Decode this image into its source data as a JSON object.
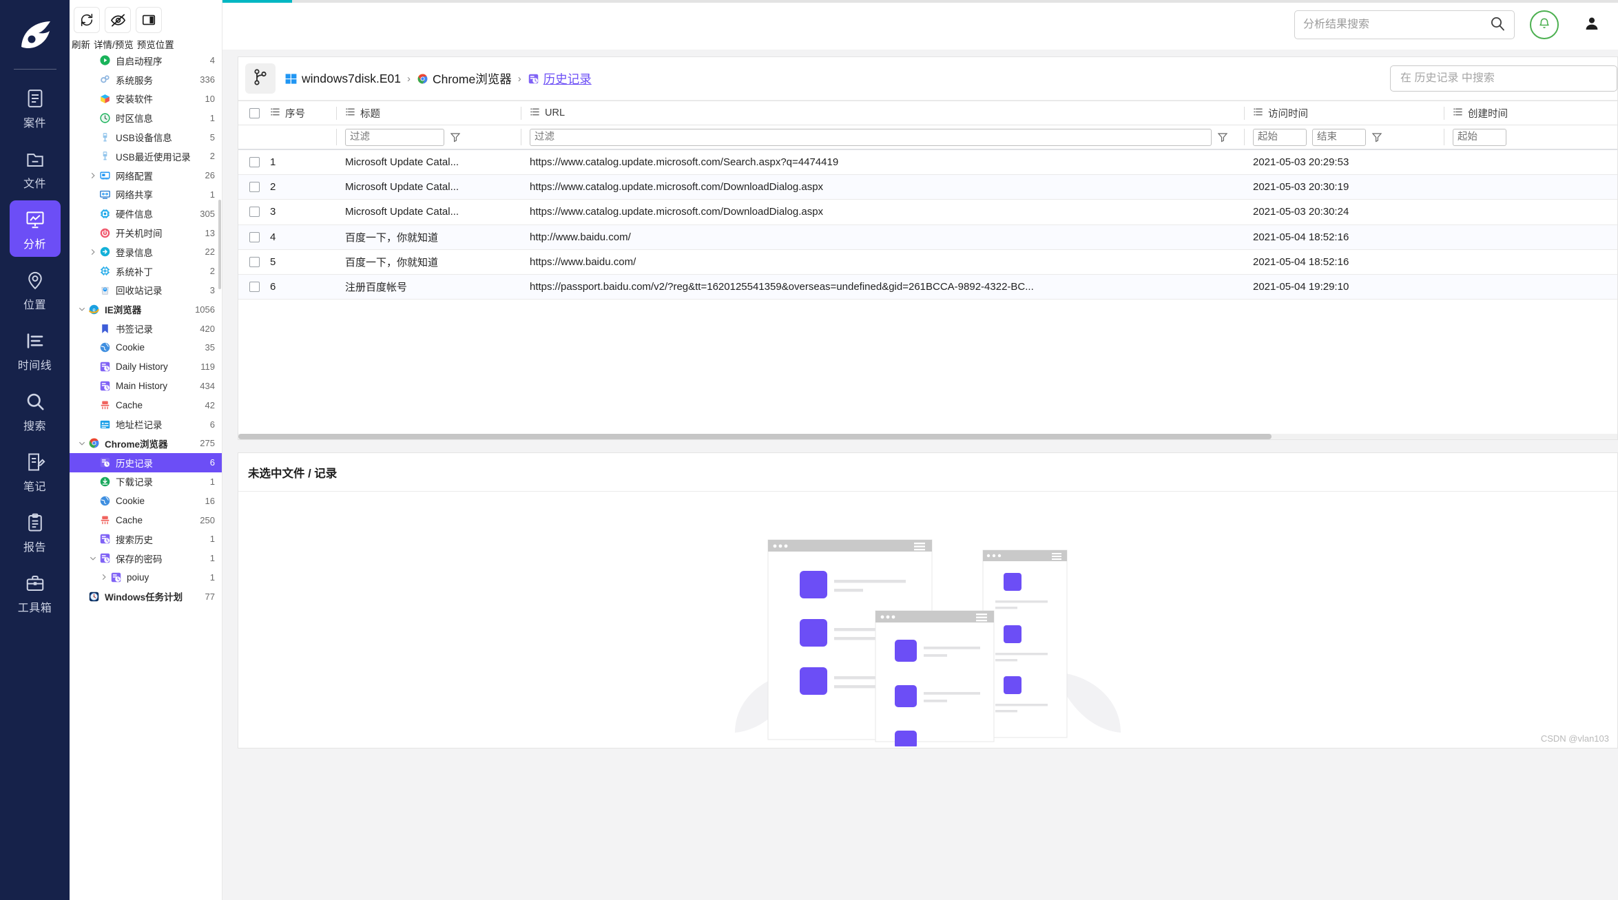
{
  "rail": {
    "logo_name": "app-logo",
    "items": [
      {
        "label": "案件",
        "icon": "case-icon",
        "active": false
      },
      {
        "label": "文件",
        "icon": "folder-icon",
        "active": false
      },
      {
        "label": "分析",
        "icon": "analysis-icon",
        "active": true
      },
      {
        "label": "位置",
        "icon": "location-icon",
        "active": false
      },
      {
        "label": "时间线",
        "icon": "timeline-icon",
        "active": false
      },
      {
        "label": "搜索",
        "icon": "search-icon",
        "active": false
      },
      {
        "label": "笔记",
        "icon": "note-icon",
        "active": false
      },
      {
        "label": "报告",
        "icon": "report-icon",
        "active": false
      },
      {
        "label": "工具箱",
        "icon": "toolbox-icon",
        "active": false
      }
    ]
  },
  "toolbar": {
    "buttons": [
      {
        "icon": "refresh-icon",
        "name": "refresh-button"
      },
      {
        "icon": "eye-off-icon",
        "name": "detail-preview-button"
      },
      {
        "icon": "panel-icon",
        "name": "preview-position-button"
      }
    ],
    "labels": [
      "刷新",
      "详情/预览",
      "预览位置"
    ]
  },
  "tree": [
    {
      "label": "自启动程序",
      "count": "4",
      "icon": "play-green-icon",
      "indent": 1,
      "caret": "none"
    },
    {
      "label": "系统服务",
      "count": "336",
      "icon": "gears-icon",
      "indent": 1,
      "caret": "none"
    },
    {
      "label": "安装软件",
      "count": "10",
      "icon": "box-icon",
      "indent": 1,
      "caret": "none"
    },
    {
      "label": "时区信息",
      "count": "1",
      "icon": "clock-icon",
      "indent": 1,
      "caret": "none"
    },
    {
      "label": "USB设备信息",
      "count": "5",
      "icon": "usb-icon",
      "indent": 1,
      "caret": "none"
    },
    {
      "label": "USB最近使用记录",
      "count": "2",
      "icon": "usb-icon",
      "indent": 1,
      "caret": "none"
    },
    {
      "label": "网络配置",
      "count": "26",
      "icon": "netcard-icon",
      "indent": 1,
      "caret": "right"
    },
    {
      "label": "网络共享",
      "count": "1",
      "icon": "netshare-icon",
      "indent": 1,
      "caret": "none"
    },
    {
      "label": "硬件信息",
      "count": "305",
      "icon": "chip-icon",
      "indent": 1,
      "caret": "none"
    },
    {
      "label": "开关机时间",
      "count": "13",
      "icon": "power-icon",
      "indent": 1,
      "caret": "none"
    },
    {
      "label": "登录信息",
      "count": "22",
      "icon": "login-icon",
      "indent": 1,
      "caret": "right"
    },
    {
      "label": "系统补丁",
      "count": "2",
      "icon": "patch-icon",
      "indent": 1,
      "caret": "none"
    },
    {
      "label": "回收站记录",
      "count": "3",
      "icon": "recycle-icon",
      "indent": 1,
      "caret": "none"
    },
    {
      "label": "IE浏览器",
      "count": "1056",
      "icon": "ie-icon",
      "indent": 0,
      "caret": "down",
      "bold": true
    },
    {
      "label": "书签记录",
      "count": "420",
      "icon": "bookmark-icon",
      "indent": 1,
      "caret": "none"
    },
    {
      "label": "Cookie",
      "count": "35",
      "icon": "globe-icon",
      "indent": 1,
      "caret": "none"
    },
    {
      "label": "Daily History",
      "count": "119",
      "icon": "history-icon",
      "indent": 1,
      "caret": "none"
    },
    {
      "label": "Main History",
      "count": "434",
      "icon": "history-icon",
      "indent": 1,
      "caret": "none"
    },
    {
      "label": "Cache",
      "count": "42",
      "icon": "cache-icon",
      "indent": 1,
      "caret": "none"
    },
    {
      "label": "地址栏记录",
      "count": "6",
      "icon": "addressbar-icon",
      "indent": 1,
      "caret": "none"
    },
    {
      "label": "Chrome浏览器",
      "count": "275",
      "icon": "chrome-icon",
      "indent": 0,
      "caret": "down",
      "bold": true
    },
    {
      "label": "历史记录",
      "count": "6",
      "icon": "history-icon",
      "indent": 1,
      "caret": "none",
      "selected": true
    },
    {
      "label": "下载记录",
      "count": "1",
      "icon": "download-icon",
      "indent": 1,
      "caret": "none"
    },
    {
      "label": "Cookie",
      "count": "16",
      "icon": "globe-icon",
      "indent": 1,
      "caret": "none"
    },
    {
      "label": "Cache",
      "count": "250",
      "icon": "cache-icon",
      "indent": 1,
      "caret": "none"
    },
    {
      "label": "搜索历史",
      "count": "1",
      "icon": "history-icon",
      "indent": 1,
      "caret": "none"
    },
    {
      "label": "保存的密码",
      "count": "1",
      "icon": "history-icon",
      "indent": 1,
      "caret": "down"
    },
    {
      "label": "poiuy",
      "count": "1",
      "icon": "history-icon",
      "indent": 2,
      "caret": "right"
    },
    {
      "label": "Windows任务计划",
      "count": "77",
      "icon": "taskclock-icon",
      "indent": 0,
      "caret": "none",
      "bold": true
    }
  ],
  "topbar": {
    "search_placeholder": "分析结果搜索",
    "progress_percent": 5
  },
  "breadcrumb": {
    "items": [
      {
        "label": "windows7disk.E01",
        "icon": "windows-icon",
        "link": false
      },
      {
        "label": "Chrome浏览器",
        "icon": "chrome-icon",
        "link": false
      },
      {
        "label": "历史记录",
        "icon": "history-icon",
        "link": true
      }
    ],
    "separator": "›",
    "search_placeholder": "在 历史记录 中搜索"
  },
  "table": {
    "columns": [
      {
        "key": "idx",
        "label": "序号"
      },
      {
        "key": "title",
        "label": "标题"
      },
      {
        "key": "url",
        "label": "URL"
      },
      {
        "key": "visit",
        "label": "访问时间"
      },
      {
        "key": "create",
        "label": "创建时间"
      }
    ],
    "filters": {
      "text_placeholder": "过滤",
      "start_placeholder": "起始",
      "end_placeholder": "结束"
    },
    "rows": [
      {
        "idx": "1",
        "title": "Microsoft Update Catal...",
        "url": "https://www.catalog.update.microsoft.com/Search.aspx?q=4474419",
        "visit": "2021-05-03 20:29:53",
        "create": ""
      },
      {
        "idx": "2",
        "title": "Microsoft Update Catal...",
        "url": "https://www.catalog.update.microsoft.com/DownloadDialog.aspx",
        "visit": "2021-05-03 20:30:19",
        "create": ""
      },
      {
        "idx": "3",
        "title": "Microsoft Update Catal...",
        "url": "https://www.catalog.update.microsoft.com/DownloadDialog.aspx",
        "visit": "2021-05-03 20:30:24",
        "create": ""
      },
      {
        "idx": "4",
        "title": "百度一下，你就知道",
        "url": "http://www.baidu.com/",
        "visit": "2021-05-04 18:52:16",
        "create": ""
      },
      {
        "idx": "5",
        "title": "百度一下，你就知道",
        "url": "https://www.baidu.com/",
        "visit": "2021-05-04 18:52:16",
        "create": ""
      },
      {
        "idx": "6",
        "title": "注册百度帐号",
        "url": "https://passport.baidu.com/v2/?reg&tt=1620125541359&overseas=undefined&gid=261BCCA-9892-4322-BC...",
        "visit": "2021-05-04 19:29:10",
        "create": ""
      }
    ]
  },
  "preview": {
    "title": "未选中文件 / 记录"
  },
  "watermark": "CSDN @vlan103",
  "colors": {
    "rail_bg": "#16224a",
    "accent": "#6c4ef6",
    "progress": "#00b7c3",
    "bell_green": "#4cb050"
  }
}
